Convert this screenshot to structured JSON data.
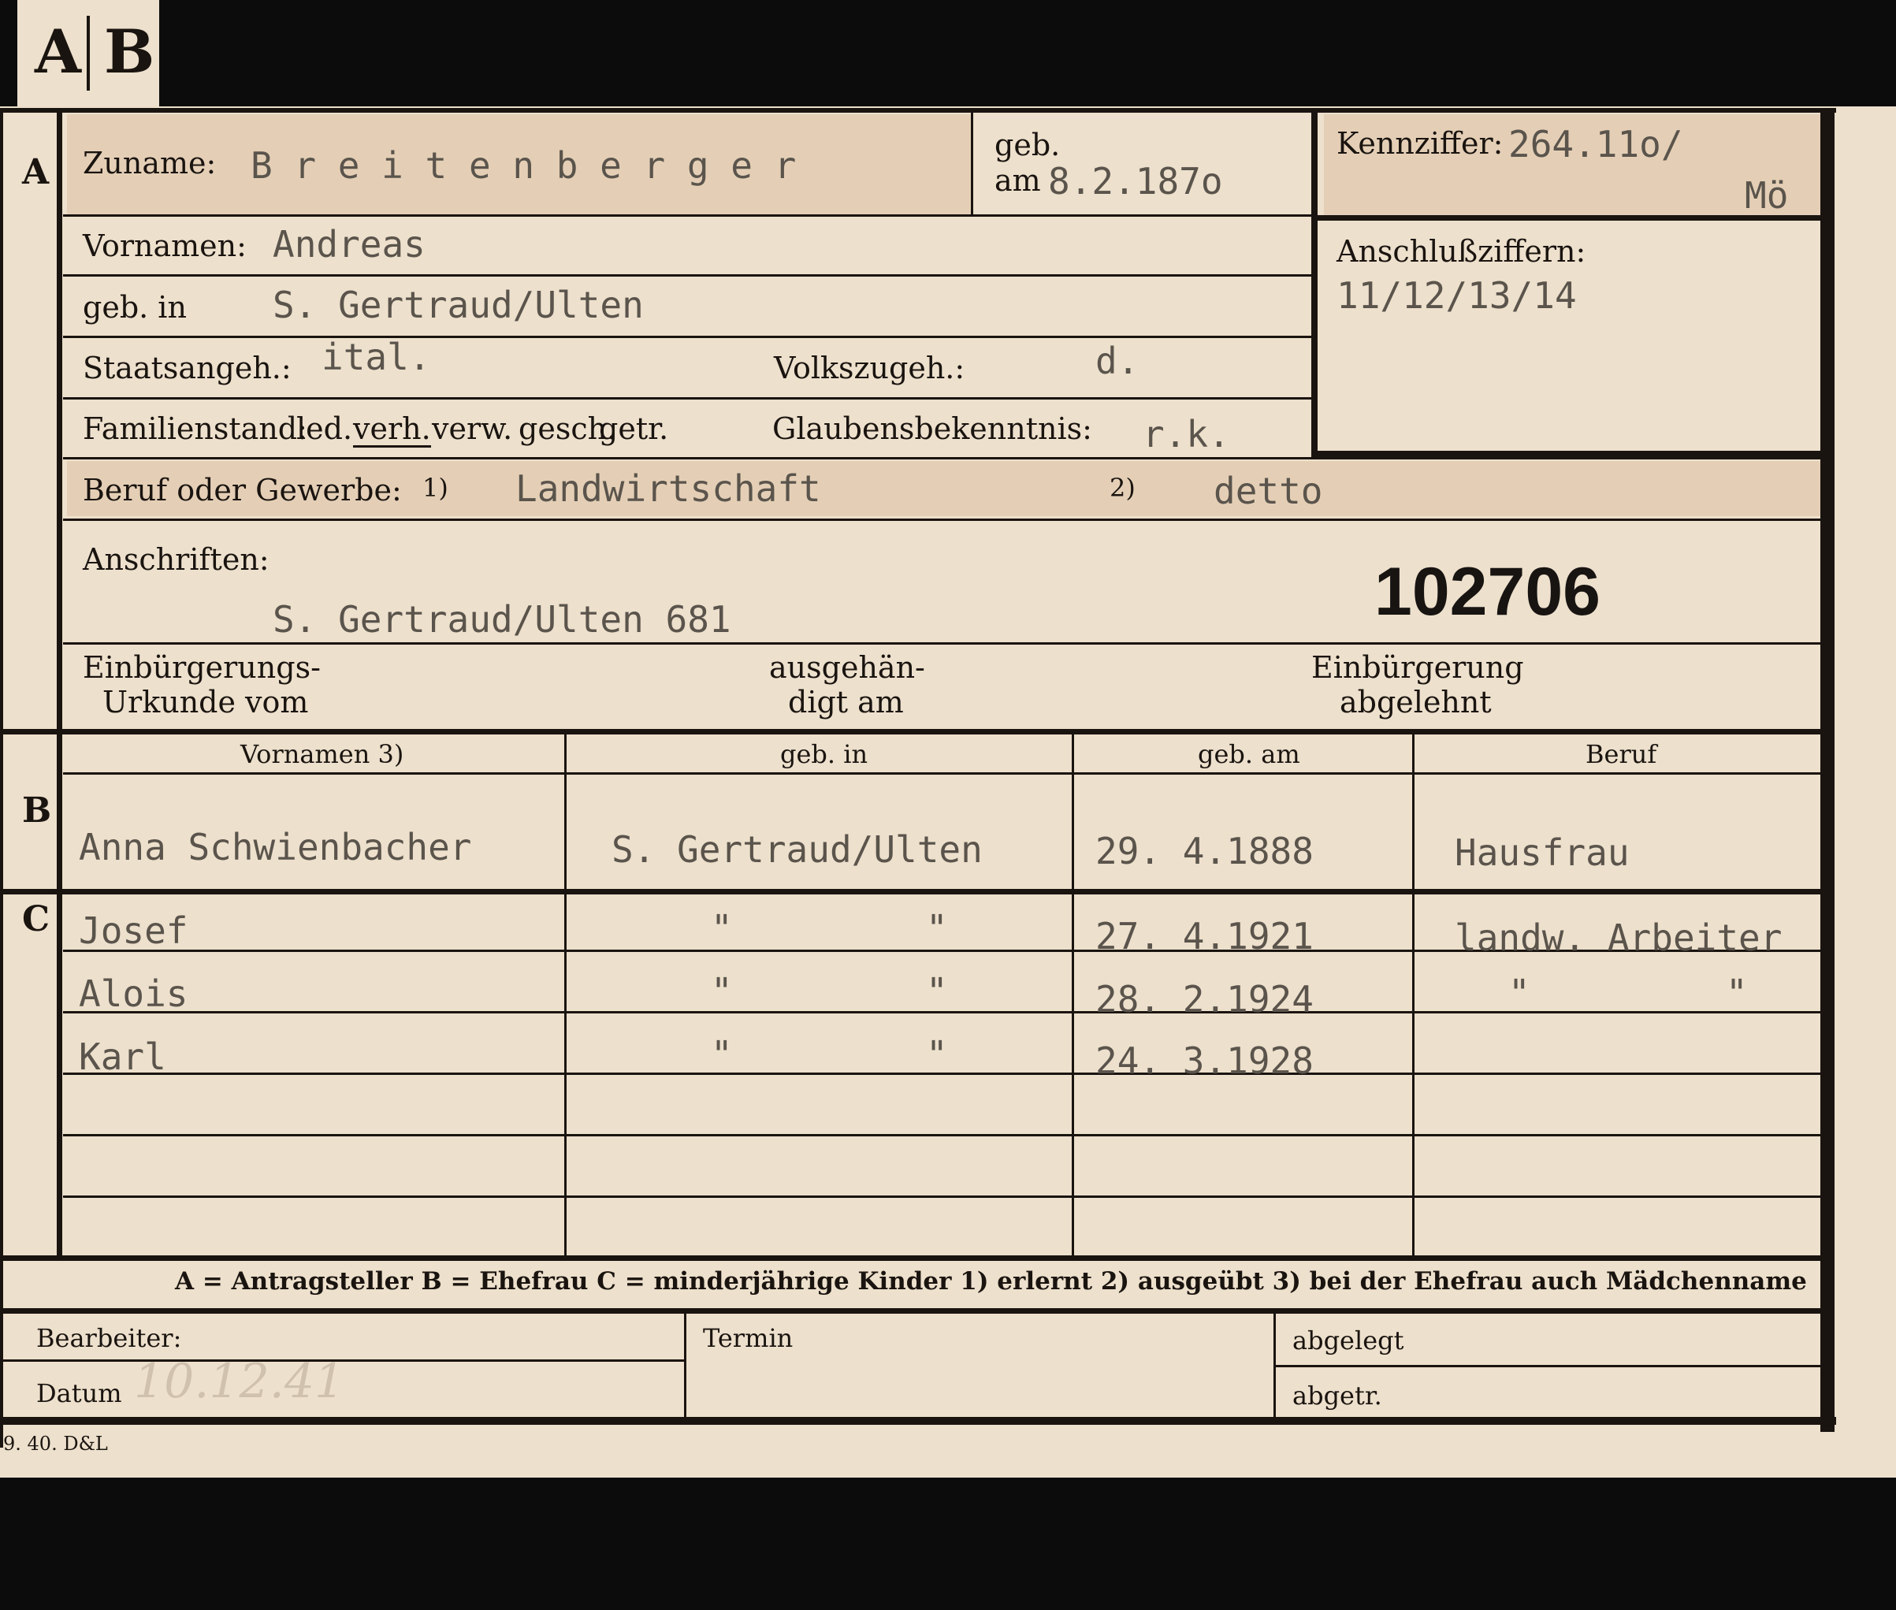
{
  "tabs": [
    "A",
    "B"
  ],
  "sections": {
    "a": "A",
    "b": "B",
    "c": "C"
  },
  "applicant": {
    "zuname_label": "Zuname:",
    "zuname": "B r e i t e n b e r g e r",
    "geb_label": "geb.",
    "geb_am_label": "am",
    "geb_am": "8.2.187o",
    "vornamen_label": "Vornamen:",
    "vornamen": "Andreas",
    "geb_in_label": "geb. in",
    "geb_in": "S. Gertraud/Ulten",
    "staatsangeh_label": "Staatsangeh.:",
    "staatsangeh": "ital.",
    "volkszugeh_label": "Volkszugeh.:",
    "volkszugeh": "d.",
    "familienstand_label": "Familienstand:",
    "familienstand_options": [
      "led.",
      "verh.",
      "verw.",
      "gesch.",
      "getr."
    ],
    "familienstand_selected": "verh.",
    "glaubens_label": "Glaubensbekenntnis:",
    "glaubens": "r.k.",
    "beruf_label": "Beruf oder Gewerbe:",
    "beruf_mark1": "1)",
    "beruf1": "Landwirtschaft",
    "beruf_mark2": "2)",
    "beruf2": "detto",
    "anschriften_label": "Anschriften:",
    "anschrift": "S. Gertraud/Ulten 681",
    "stamp_number": "102706",
    "einb_urkunde_label": [
      "Einbürgerungs-",
      "Urkunde vom"
    ],
    "ausgehaendigt_label": [
      "ausgehän-",
      "digt am"
    ],
    "einb_abgelehnt_label": [
      "Einbürgerung",
      "abgelehnt"
    ]
  },
  "kennziffer": {
    "label": "Kennziffer:",
    "value": "264.11o/",
    "suffix": "Mö"
  },
  "anschlussziffern": {
    "label": "Anschlußziffern:",
    "value": "11/12/13/14"
  },
  "table": {
    "headers": [
      "Vornamen 3)",
      "geb. in",
      "geb. am",
      "Beruf"
    ],
    "spouse": {
      "vorname": "Anna Schwienbacher",
      "geb_in": "S. Gertraud/Ulten",
      "geb_am": "29. 4.1888",
      "beruf": "Hausfrau"
    },
    "children": [
      {
        "vorname": "Josef",
        "geb_in_a": "\"",
        "geb_in_b": "\"",
        "geb_am": "27. 4.1921",
        "beruf": "landw. Arbeiter"
      },
      {
        "vorname": "Alois",
        "geb_in_a": "\"",
        "geb_in_b": "\"",
        "geb_am": "28. 2.1924",
        "beruf_a": "\"",
        "beruf_b": "\""
      },
      {
        "vorname": "Karl",
        "geb_in_a": "\"",
        "geb_in_b": "\"",
        "geb_am": "24. 3.1928"
      }
    ]
  },
  "legend": "A = Antragsteller   B = Ehefrau   C = minderjährige Kinder   1) erlernt   2) ausgeübt   3) bei der Ehefrau auch Mädchenname",
  "footer": {
    "bearbeiter_label": "Bearbeiter:",
    "datum_label": "Datum",
    "datum_value": "10.12.41",
    "termin_label": "Termin",
    "abgelegt_label": "abgelegt",
    "abgetr_label": "abgetr."
  },
  "printer_mark": "9. 40. D&L"
}
